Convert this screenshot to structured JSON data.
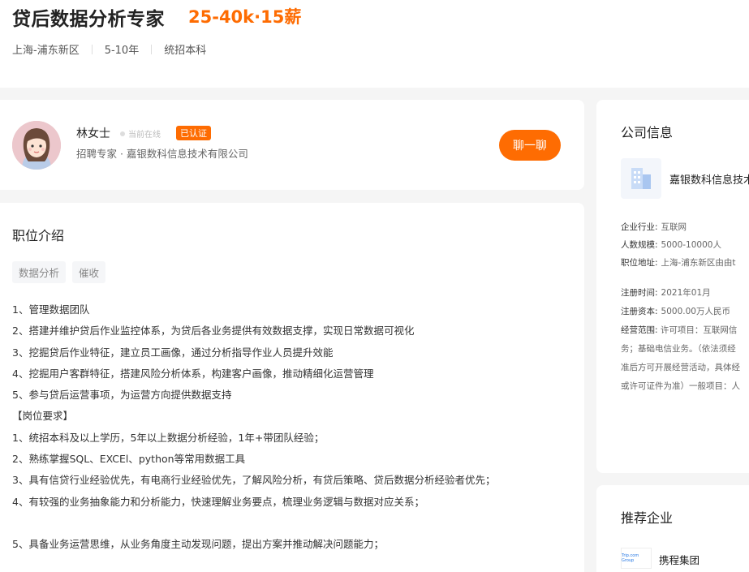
{
  "job": {
    "title": "贷后数据分析专家",
    "salary": "25-40k·15薪",
    "location": "上海-浦东新区",
    "experience": "5-10年",
    "education": "统招本科"
  },
  "recruiter": {
    "name": "林女士",
    "status": "当前在线",
    "badge": "已认证",
    "role": "招聘专家 · 嘉银数科信息技术有限公司",
    "chat_label": "聊一聊"
  },
  "description": {
    "title": "职位介绍",
    "tags": [
      "数据分析",
      "催收"
    ],
    "lines": [
      "1、管理数据团队",
      "2、搭建并维护贷后作业监控体系，为贷后各业务提供有效数据支撑，实现日常数据可视化",
      "3、挖掘贷后作业特征，建立员工画像，通过分析指导作业人员提升效能",
      "4、挖掘用户客群特征，搭建风险分析体系，构建客户画像，推动精细化运营管理",
      "5、参与贷后运营事项，为运营方向提供数据支持",
      "【岗位要求】",
      "1、统招本科及以上学历，5年以上数据分析经验，1年+带团队经验；",
      "2、熟练掌握SQL、EXCEl、python等常用数据工具",
      "3、具有信贷行业经验优先，有电商行业经验优先，了解风险分析，有贷后策略、贷后数据分析经验者优先；",
      "4、有较强的业务抽象能力和分析能力，快速理解业务要点，梳理业务逻辑与数据对应关系；",
      "",
      "5、具备业务运营思维，从业务角度主动发现问题，提出方案并推动解决问题能力；"
    ]
  },
  "company": {
    "title": "公司信息",
    "name": "嘉银数科信息技术",
    "industry_label": "企业行业:",
    "industry": "互联网",
    "size_label": "人数规模:",
    "size": "5000-10000人",
    "address_label": "职位地址:",
    "address": "上海-浦东新区由由t",
    "reg_time_label": "注册时间:",
    "reg_time": "2021年01月",
    "capital_label": "注册资本:",
    "capital": "5000.00万人民币",
    "scope_label": "经营范围:",
    "scope_lines": [
      "许可项目：互联网信",
      "务；基础电信业务。（依法须经",
      "准后方可开展经营活动，具体经",
      "或许可证件为准）一般项目：人"
    ]
  },
  "recommend": {
    "title": "推荐企业",
    "logo_text": "Trip.com Group",
    "company": "携程集团"
  }
}
